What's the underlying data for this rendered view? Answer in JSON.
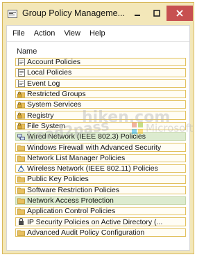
{
  "window": {
    "title": "Group Policy Manageme..."
  },
  "menu": [
    "File",
    "Action",
    "View",
    "Help"
  ],
  "list": {
    "column_header": "Name",
    "items": [
      {
        "label": "Account Policies",
        "icon": "document-icon",
        "highlighted": false
      },
      {
        "label": "Local Policies",
        "icon": "document-icon",
        "highlighted": false
      },
      {
        "label": "Event Log",
        "icon": "document-icon",
        "highlighted": false
      },
      {
        "label": "Restricted Groups",
        "icon": "lock-folder-icon",
        "highlighted": false
      },
      {
        "label": "System Services",
        "icon": "lock-folder-icon",
        "highlighted": false
      },
      {
        "label": "Registry",
        "icon": "lock-folder-icon",
        "highlighted": false
      },
      {
        "label": "File System",
        "icon": "lock-folder-icon",
        "highlighted": false
      },
      {
        "label": "Wired Network (IEEE 802.3) Policies",
        "icon": "network-icon",
        "highlighted": true
      },
      {
        "label": "Windows Firewall with Advanced Security",
        "icon": "folder-icon",
        "highlighted": false
      },
      {
        "label": "Network List Manager Policies",
        "icon": "folder-icon",
        "highlighted": false
      },
      {
        "label": "Wireless Network (IEEE 802.11) Policies",
        "icon": "wireless-icon",
        "highlighted": false
      },
      {
        "label": "Public Key Policies",
        "icon": "folder-icon",
        "highlighted": false
      },
      {
        "label": "Software Restriction Policies",
        "icon": "folder-icon",
        "highlighted": false
      },
      {
        "label": "Network Access Protection",
        "icon": "folder-icon",
        "highlighted": true
      },
      {
        "label": "Application Control Policies",
        "icon": "folder-icon",
        "highlighted": false
      },
      {
        "label": "IP Security Policies on Active Directory (...",
        "icon": "ipsec-icon",
        "highlighted": false
      },
      {
        "label": "Advanced Audit Policy Configuration",
        "icon": "folder-icon",
        "highlighted": false
      }
    ]
  },
  "watermark": {
    "text1": "Lead2pass",
    "text2": "hiken.com",
    "text3": "Microsoft"
  },
  "colors": {
    "frame": "#f3e7b9",
    "row_border": "#e2c15e",
    "highlight": "#dcebcf",
    "close_button": "#c75050",
    "folder": "#e8c060"
  }
}
